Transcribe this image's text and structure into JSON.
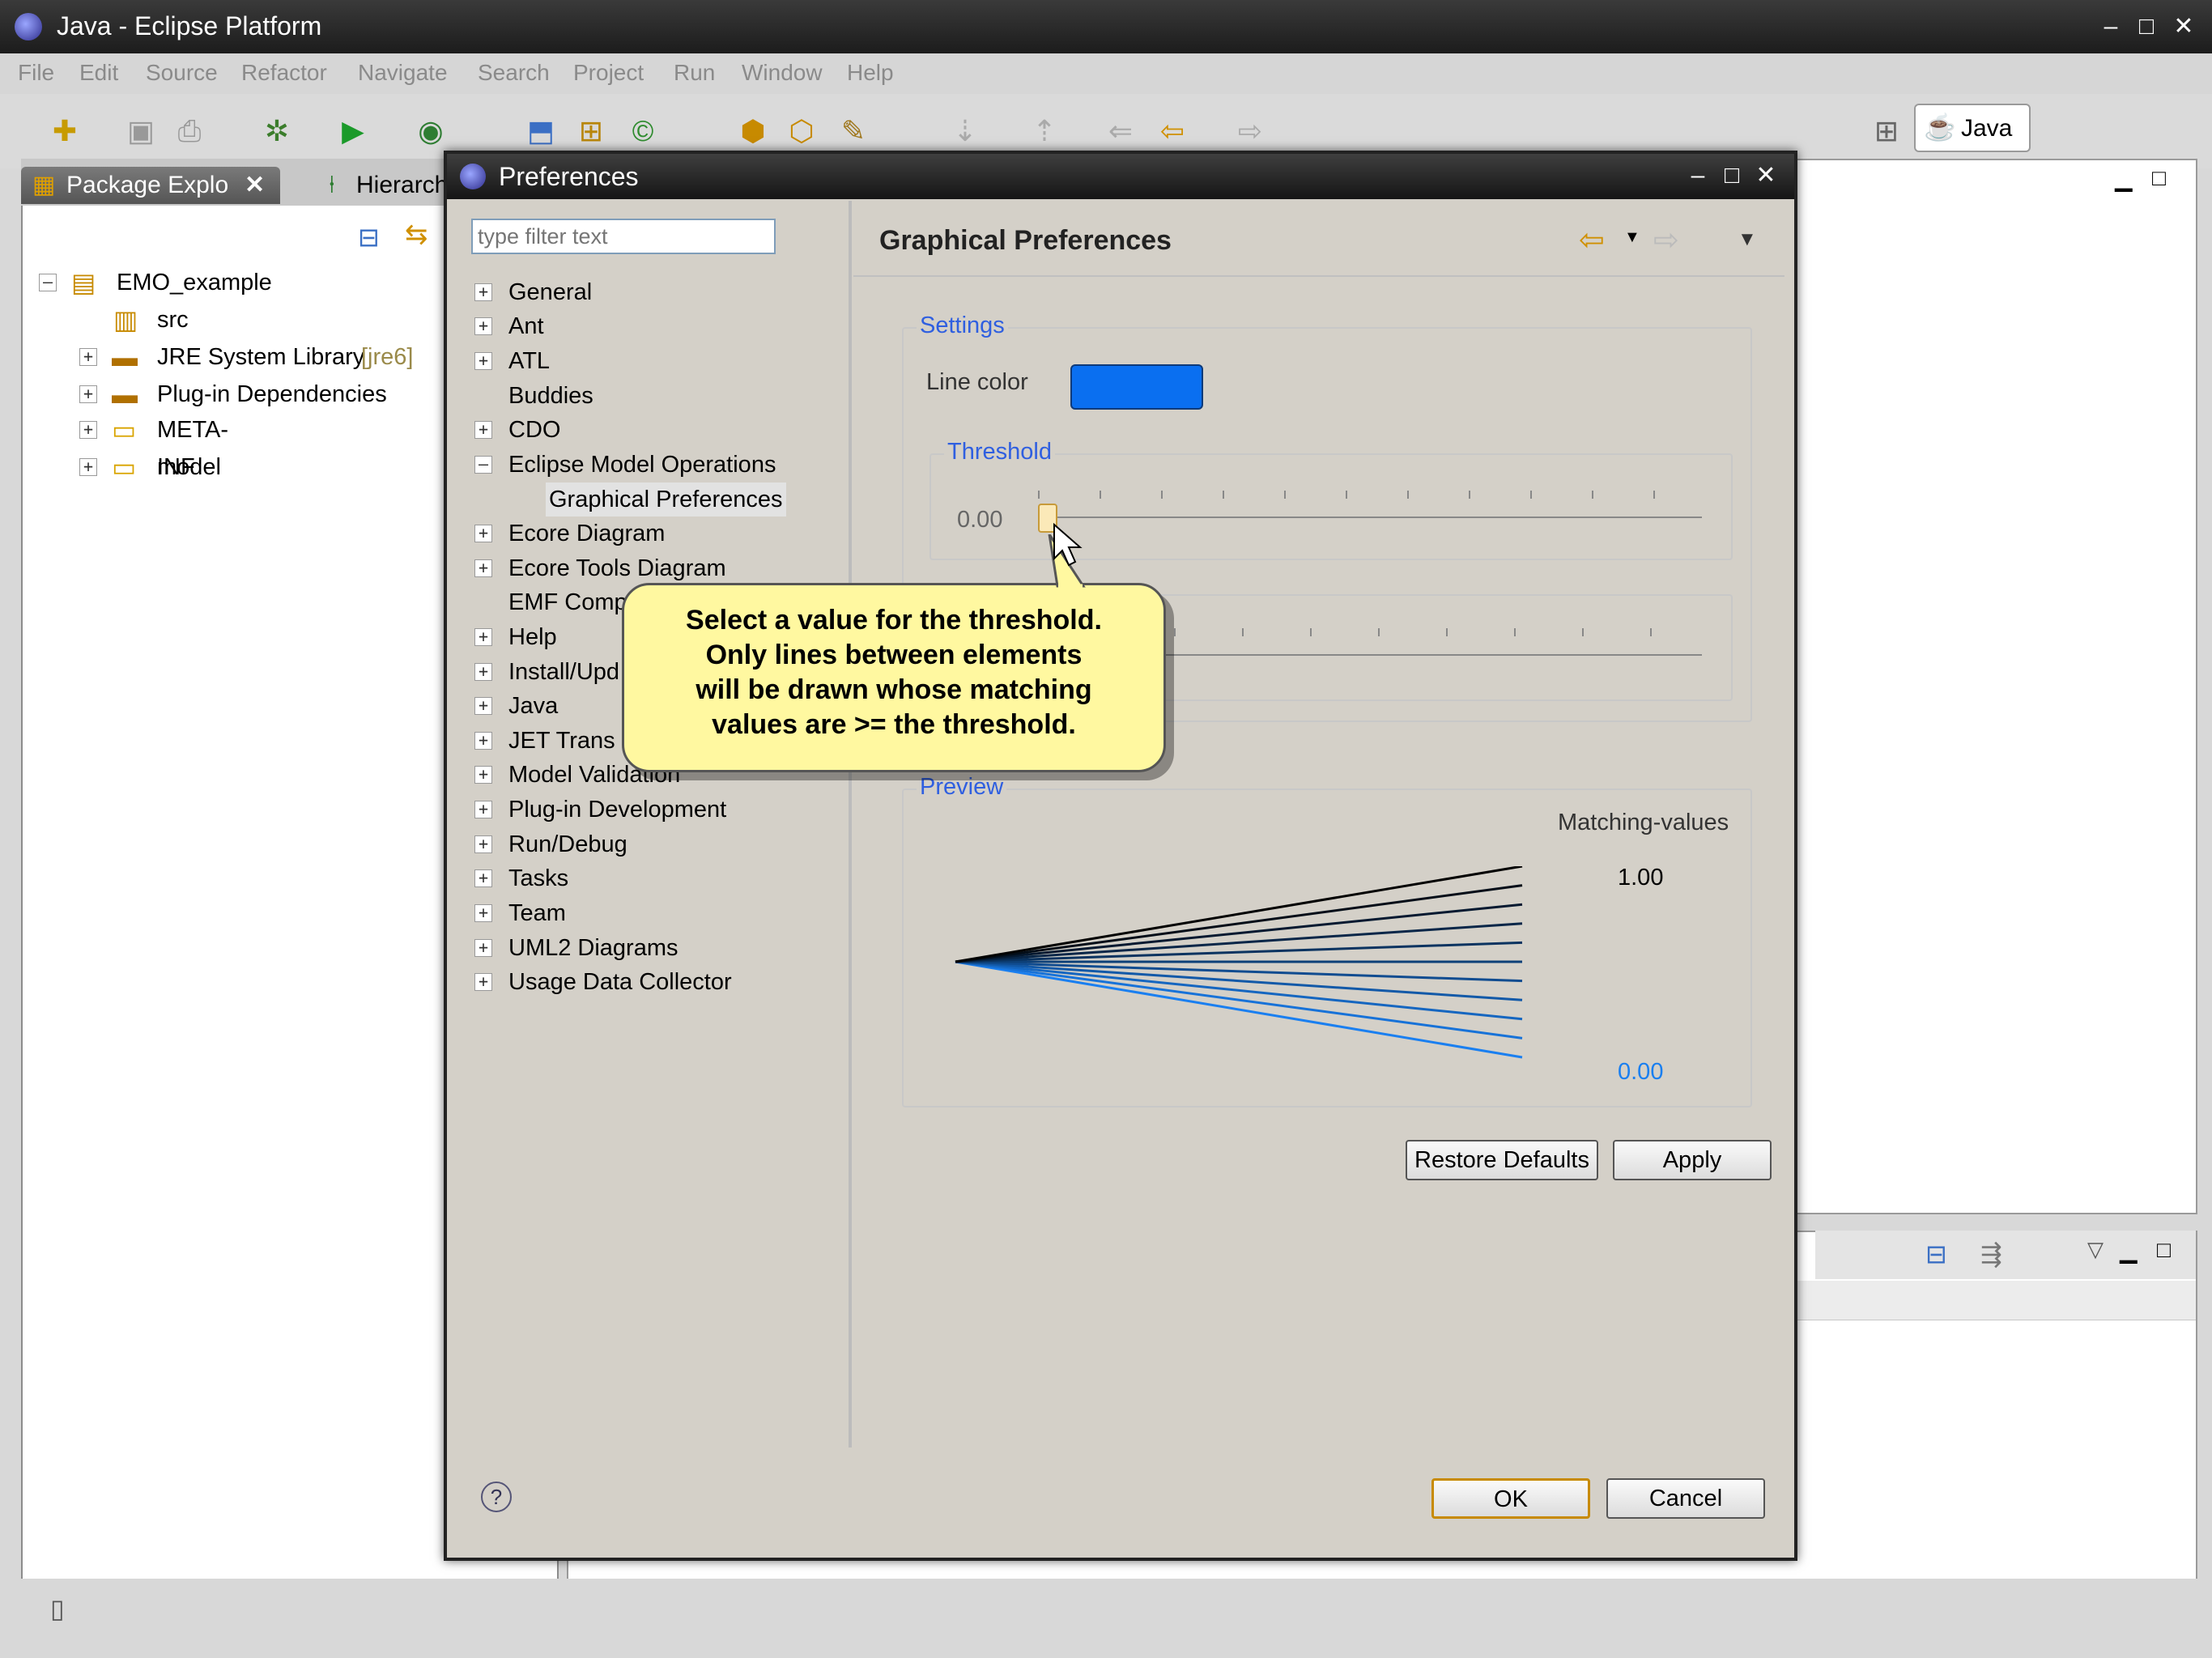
{
  "window": {
    "title": "Java - Eclipse Platform"
  },
  "menu": [
    "File",
    "Edit",
    "Source",
    "Refactor",
    "Navigate",
    "Search",
    "Project",
    "Run",
    "Window",
    "Help"
  ],
  "perspective": {
    "label": "Java"
  },
  "package_explorer": {
    "tabs": [
      "Package Explo",
      "Hierarch"
    ],
    "items": [
      {
        "label": "EMO_example"
      },
      {
        "label": "src"
      },
      {
        "label": "JRE System Library",
        "suffix": "[jre6]"
      },
      {
        "label": "Plug-in Dependencies"
      },
      {
        "label": "META-INF"
      },
      {
        "label": "model"
      }
    ]
  },
  "dialog": {
    "title": "Preferences",
    "filter_placeholder": "type filter text",
    "tree": [
      "General",
      "Ant",
      "ATL",
      "Buddies",
      "CDO",
      "Eclipse Model Operations",
      "Graphical Preferences",
      "Ecore Diagram",
      "Ecore Tools Diagram",
      "EMF Comp",
      "Help",
      "Install/Upd",
      "Java",
      "JET Trans",
      "Model Validation",
      "Plug-in Development",
      "Run/Debug",
      "Tasks",
      "Team",
      "UML2 Diagrams",
      "Usage Data Collector"
    ],
    "page_title": "Graphical Preferences",
    "settings": {
      "group_label": "Settings",
      "line_color_label": "Line color",
      "line_color": "#0a6ff0",
      "threshold_label": "Threshold",
      "threshold_value": "0.00"
    },
    "preview": {
      "group_label": "Preview",
      "matching_label": "Matching-values",
      "max_label": "1.00",
      "min_label": "0.00",
      "low_color": "#1a7ff0",
      "high_color": "#000000"
    },
    "buttons": {
      "restore": "Restore Defaults",
      "apply": "Apply",
      "ok": "OK",
      "cancel": "Cancel"
    },
    "tooltip": "Select a value for the threshold.\nOnly lines between elements\nwill be drawn whose matching\nvalues are >= the threshold."
  }
}
